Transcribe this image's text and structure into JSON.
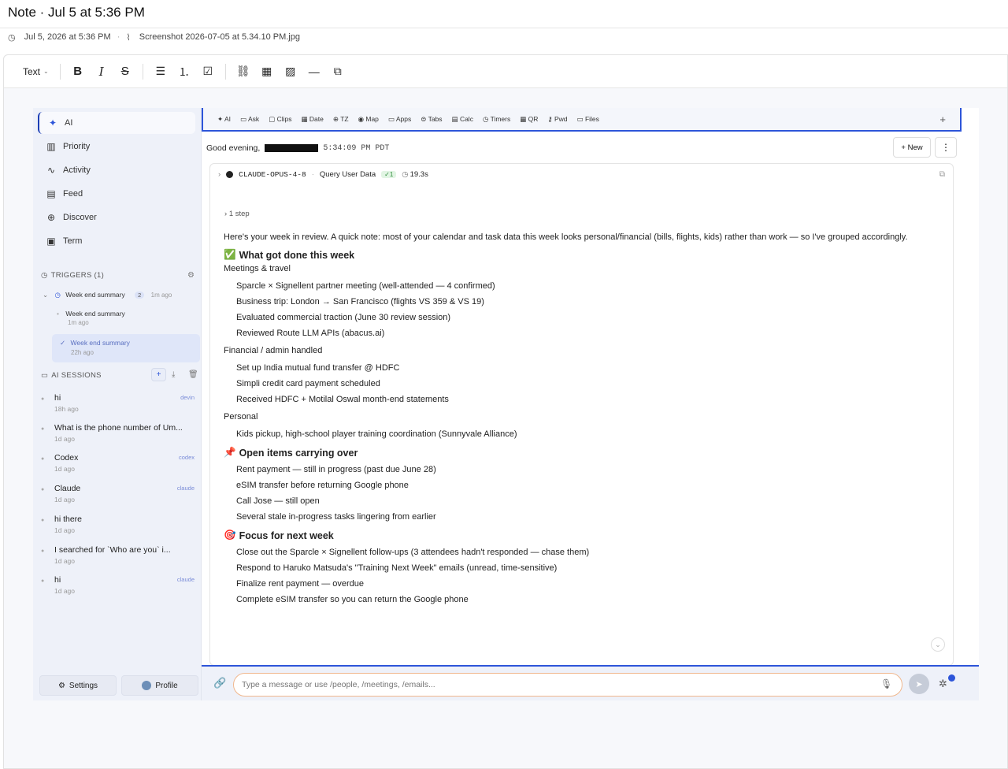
{
  "note": {
    "title": "Note · Jul 5 at 5:36 PM",
    "date": "Jul 5, 2026 at 5:36 PM",
    "attachment": "Screenshot 2026-07-05 at 5.34.10 PM.jpg"
  },
  "toolbar": {
    "text_style": "Text"
  },
  "app": {
    "nav": [
      {
        "icon": "✦",
        "label": "AI"
      },
      {
        "icon": "▥",
        "label": "Priority"
      },
      {
        "icon": "∿",
        "label": "Activity"
      },
      {
        "icon": "▤",
        "label": "Feed"
      },
      {
        "icon": "⊕",
        "label": "Discover"
      },
      {
        "icon": "▣",
        "label": "Term"
      }
    ],
    "triggers_heading": "TRIGGERS (1)",
    "trigger_main": {
      "label": "Week end summary",
      "count": "2",
      "time": "1m ago"
    },
    "trigger_runs": [
      {
        "label": "Week end summary",
        "time": "1m ago"
      },
      {
        "label": "Week end summary",
        "time": "22h ago"
      }
    ],
    "sessions_heading": "AI SESSIONS",
    "sessions": [
      {
        "name": "hi",
        "time": "18h ago",
        "tag": "devin"
      },
      {
        "name": "What is the phone number of Um...",
        "time": "1d ago",
        "tag": ""
      },
      {
        "name": "Codex",
        "time": "1d ago",
        "tag": "codex"
      },
      {
        "name": "Claude",
        "time": "1d ago",
        "tag": "claude"
      },
      {
        "name": "hi there",
        "time": "1d ago",
        "tag": ""
      },
      {
        "name": "I searched for `Who are you` i...",
        "time": "1d ago",
        "tag": ""
      },
      {
        "name": "hi",
        "time": "1d ago",
        "tag": "claude"
      }
    ],
    "settings_label": "Settings",
    "profile_label": "Profile",
    "appbar": [
      "AI",
      "Ask",
      "Clips",
      "Date",
      "TZ",
      "Map",
      "Apps",
      "Tabs",
      "Calc",
      "Timers",
      "QR",
      "Pwd",
      "Files"
    ],
    "greeting": "Good evening,",
    "clock": "5:34:09 PM PDT",
    "new_label": "+ New",
    "chat": {
      "model": "CLAUDE-OPUS-4-8",
      "tool": "Query User Data",
      "badge": "✓1",
      "duration": "19.3s",
      "steps": "1 step",
      "intro": "Here's your week in review. A quick note: most of your calendar and task data this week looks personal/financial (bills, flights, kids) rather than work — so I've grouped accordingly.",
      "sec1_title": "What got done this week",
      "sec1_emoji": "✅",
      "grp1": "Meetings & travel",
      "grp1_items": [
        "Sparcle × Signellent partner meeting (well-attended — 4 confirmed)",
        "Business trip: London → San Francisco (flights VS 359 & VS 19)",
        "Evaluated commercial traction (June 30 review session)",
        "Reviewed Route LLM APIs (abacus.ai)"
      ],
      "grp2": "Financial / admin handled",
      "grp2_items": [
        "Set up India mutual fund transfer @ HDFC",
        "Simpli credit card payment scheduled",
        "Received HDFC + Motilal Oswal month-end statements"
      ],
      "grp3": "Personal",
      "grp3_items": [
        "Kids pickup, high-school player training coordination (Sunnyvale Alliance)"
      ],
      "sec2_title": "Open items carrying over",
      "sec2_emoji": "📌",
      "sec2_items": [
        "Rent payment — still in progress (past due June 28)",
        "eSIM transfer before returning Google phone",
        "Call Jose — still open",
        "Several stale in-progress tasks lingering from earlier"
      ],
      "sec3_title": "Focus for next week",
      "sec3_emoji": "🎯",
      "sec3_items": [
        "Close out the Sparcle × Signellent follow-ups (3 attendees hadn't responded — chase them)",
        "Respond to Haruko Matsuda's \"Training Next Week\" emails (unread, time-sensitive)",
        "Finalize rent payment — overdue",
        "Complete eSIM transfer so you can return the Google phone"
      ]
    },
    "input_placeholder": "Type a message or use /people, /meetings, /emails..."
  }
}
